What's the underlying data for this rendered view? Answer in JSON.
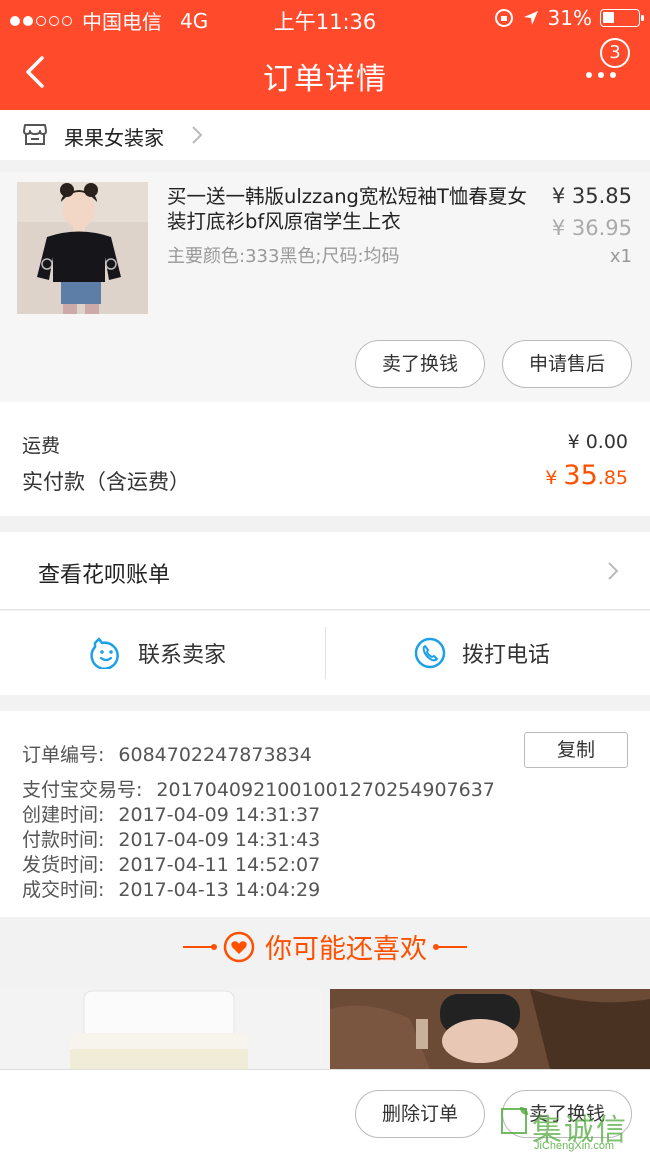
{
  "status_bar": {
    "carrier": "中国电信",
    "network": "4G",
    "time": "上午11:36",
    "battery_text": "31%",
    "battery_level": 0.31
  },
  "header": {
    "title": "订单详情",
    "badge_count": "3",
    "back_icon": "chevron-left-icon",
    "more_icon": "more-icon"
  },
  "shop": {
    "name": "果果女装家"
  },
  "product": {
    "title": "买一送一韩版ulzzang宽松短袖T恤春夏女装打底衫bf风原宿学生上衣",
    "spec": "主要颜色:333黑色;尺码:均码",
    "price": "¥ 35.85",
    "original_price": "¥ 36.95",
    "quantity": "x1",
    "buttons": [
      "卖了换钱",
      "申请售后"
    ]
  },
  "fees": {
    "shipping_label": "运费",
    "shipping_value": "¥ 0.00",
    "total_label": "实付款（含运费）",
    "total_symbol": "¥",
    "total_int": "35",
    "total_dec": ".85"
  },
  "huabei": {
    "label": "查看花呗账单"
  },
  "contact": {
    "seller_label": "联系卖家",
    "phone_label": "拨打电话"
  },
  "order_info": {
    "order_no_label": "订单编号:",
    "order_no": "6084702247873834",
    "copy_label": "复制",
    "alipay_label": "支付宝交易号:",
    "alipay_no": "2017040921001001270254907637",
    "created_label": "创建时间:",
    "created": "2017-04-09 14:31:37",
    "paid_label": "付款时间:",
    "paid": "2017-04-09 14:31:43",
    "shipped_label": "发货时间:",
    "shipped": "2017-04-11 14:52:07",
    "completed_label": "成交时间:",
    "completed": "2017-04-13 14:04:29"
  },
  "recommend": {
    "title": "你可能还喜欢"
  },
  "bottom_bar": {
    "delete_label": "删除订单",
    "sell_label": "卖了换钱"
  },
  "watermark": {
    "text": "集诚信",
    "sub": "JiChengXin.com"
  },
  "colors": {
    "brand": "#ff4a2c",
    "price": "#ff5000"
  }
}
